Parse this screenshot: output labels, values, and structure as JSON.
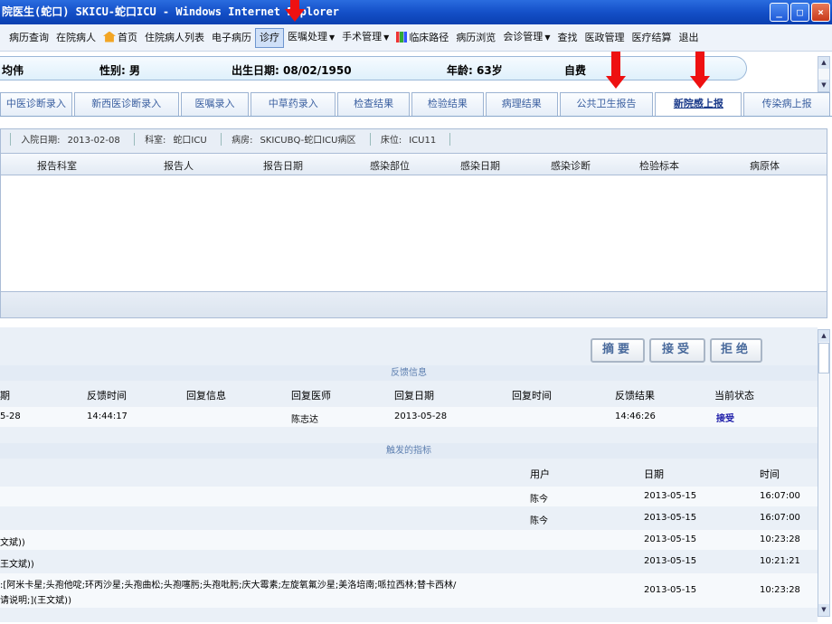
{
  "window": {
    "title": "院医生(蛇口) SKICU-蛇口ICU - Windows Internet Explorer",
    "buttons": [
      "_",
      "□",
      "×"
    ]
  },
  "menu": {
    "items": [
      {
        "label": "病历查询"
      },
      {
        "label": "在院病人"
      },
      {
        "label": "首页",
        "icon": "home-icon"
      },
      {
        "label": "住院病人列表"
      },
      {
        "label": "电子病历"
      },
      {
        "label": "诊疗",
        "selected": true
      },
      {
        "label": "医嘱处理",
        "dropdown": true
      },
      {
        "label": "手术管理",
        "dropdown": true
      },
      {
        "label": "临床路径",
        "icon": "bar-chart-icon"
      },
      {
        "label": "病历浏览"
      },
      {
        "label": "会诊管理",
        "dropdown": true
      },
      {
        "label": "查找"
      },
      {
        "label": "医政管理"
      },
      {
        "label": "医疗结算"
      },
      {
        "label": "退出"
      }
    ]
  },
  "patient": {
    "name": "均伟",
    "gender": "性别: 男",
    "birth": "出生日期: 08/02/1950",
    "age": "年龄: 63岁",
    "payment": "自费"
  },
  "tabs": [
    {
      "label": "中医诊断录入"
    },
    {
      "label": "新西医诊断录入"
    },
    {
      "label": "医嘱录入"
    },
    {
      "label": "中草药录入"
    },
    {
      "label": "检查结果"
    },
    {
      "label": "检验结果"
    },
    {
      "label": "病理结果"
    },
    {
      "label": "公共卫生报告"
    },
    {
      "label": "新院感上报",
      "active": true
    },
    {
      "label": "传染病上报"
    }
  ],
  "admission": {
    "date_label": "入院日期:",
    "date": "2013-02-08",
    "dept_label": "科室:",
    "dept": "蛇口ICU",
    "ward_label": "病房:",
    "ward": "SKICUBQ-蛇口ICU病区",
    "bed_label": "床位:",
    "bed": "ICU11"
  },
  "report_grid": {
    "columns": [
      "报告科室",
      "报告人",
      "报告日期",
      "感染部位",
      "感染日期",
      "感染诊断",
      "检验标本",
      "病原体"
    ]
  },
  "actions": {
    "summary": "摘要",
    "accept": "接受",
    "reject": "拒绝"
  },
  "feedback": {
    "section_title": "反馈信息",
    "columns": [
      "期",
      "反馈时间",
      "回复信息",
      "回复医师",
      "回复日期",
      "回复时间",
      "反馈结果",
      "当前状态"
    ],
    "rows": [
      {
        "date": "5-28",
        "time": "14:44:17",
        "info": "",
        "doctor": "陈志达",
        "reply_date": "2013-05-28",
        "reply_time": "",
        "result": "14:46:26",
        "status": "接受"
      }
    ]
  },
  "triggers": {
    "section_title": "触发的指标",
    "columns": [
      "用户",
      "日期",
      "时间"
    ],
    "rows": [
      {
        "text": "",
        "user": "陈今",
        "date": "2013-05-15",
        "time": "16:07:00"
      },
      {
        "text": "",
        "user": "陈今",
        "date": "2013-05-15",
        "time": "16:07:00"
      },
      {
        "text": "文斌))",
        "user": "",
        "date": "2013-05-15",
        "time": "10:23:28"
      },
      {
        "text": "王文斌))",
        "user": "",
        "date": "2013-05-15",
        "time": "10:21:21"
      },
      {
        "text": ":[阿米卡星;头孢他啶;环丙沙星;头孢曲松;头孢噻肟;头孢吡肟;庆大霉素;左旋氧氟沙星;美洛培南;哌拉西林;替卡西林/",
        "text2": "请说明;](王文斌))",
        "user": "",
        "date": "2013-05-15",
        "time": "10:23:28"
      }
    ]
  },
  "colors": {
    "titlebar": "#1450c8",
    "arrow": "#ee1111",
    "status_accept": "#1a1aa8",
    "tab_text": "#3a5fa0"
  }
}
